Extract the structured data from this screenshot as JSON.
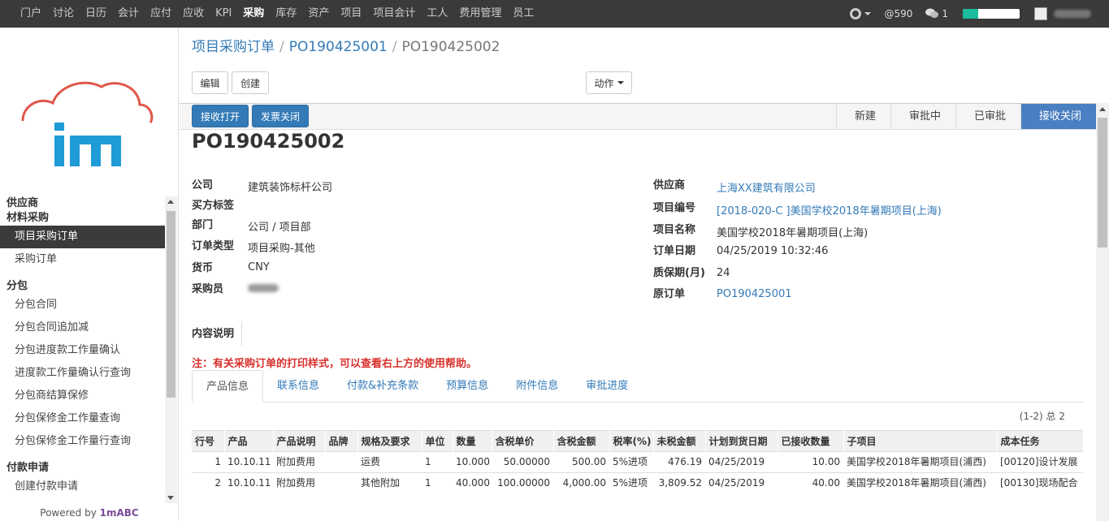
{
  "topmenu": [
    "门户",
    "讨论",
    "日历",
    "会计",
    "应付",
    "应收",
    "KPI",
    "采购",
    "库存",
    "资产",
    "项目",
    "项目会计",
    "工人",
    "费用管理",
    "员工"
  ],
  "topmenu_active": "采购",
  "topbar": {
    "at_count": "@590",
    "chat_count": "1",
    "progress_fraction": 0.27,
    "accent": "#1abc9c"
  },
  "sidebar": {
    "groups": [
      {
        "title": "供应商",
        "items": []
      },
      {
        "title": "材料采购",
        "items": [
          "项目采购订单",
          "采购订单"
        ]
      },
      {
        "title": "分包",
        "items": [
          "分包合同",
          "分包合同追加减",
          "分包进度款工作量确认",
          "进度款工作量确认行查询",
          "分包商结算保修",
          "分包保修金工作量查询",
          "分包保修金工作量行查询"
        ]
      },
      {
        "title": "付款申请",
        "items": [
          "创建付款申请"
        ]
      }
    ],
    "active_item": "项目采购订单",
    "powered_prefix": "Powered by ",
    "powered_brand": "1mABC"
  },
  "breadcrumb": {
    "root": "项目采购订单",
    "parent": "PO190425001",
    "current": "PO190425002"
  },
  "toolbar": {
    "edit": "编辑",
    "create": "创建",
    "action": "动作"
  },
  "status_buttons": {
    "receive_open": "接收打开",
    "invoice_close": "发票关闭"
  },
  "stages": [
    "新建",
    "审批中",
    "已审批",
    "接收关闭"
  ],
  "active_stage": "接收关闭",
  "doc_name": "PO190425002",
  "left_fields": [
    {
      "label": "公司",
      "value": "建筑装饰标杆公司"
    },
    {
      "label": "买方标签",
      "value": ""
    },
    {
      "label": "部门",
      "value": "公司 / 项目部"
    },
    {
      "label": "订单类型",
      "value": "项目采购-其他"
    },
    {
      "label": "货币",
      "value": "CNY"
    },
    {
      "label": "采购员",
      "value": ""
    }
  ],
  "right_fields": [
    {
      "label": "供应商",
      "value": "上海XX建筑有限公司",
      "link": true
    },
    {
      "label": "项目编号",
      "value": "[2018-020-C ]美国学校2018年暑期项目(上海)",
      "link": true
    },
    {
      "label": "项目名称",
      "value": "美国学校2018年暑期项目(上海)",
      "link": false
    },
    {
      "label": "订单日期",
      "value": "04/25/2019 10:32:46",
      "link": false
    },
    {
      "label": "质保期(月)",
      "value": "24",
      "link": false
    },
    {
      "label": "原订单",
      "value": "PO190425001",
      "link": true
    }
  ],
  "content_label": "内容说明",
  "note": "注：有关采购订单的打印样式，可以查看右上方的使用帮助。",
  "tabs": [
    "产品信息",
    "联系信息",
    "付款&补充条款",
    "预算信息",
    "附件信息",
    "审批进度"
  ],
  "active_tab": "产品信息",
  "pager": "(1-2) 总 2",
  "table": {
    "headers": [
      "行号",
      "产品",
      "产品说明",
      "品牌",
      "规格及要求",
      "单位",
      "数量",
      "含税单价",
      "含税金额",
      "税率(%)",
      "未税金额",
      "计划到货日期",
      "已接收数量",
      "子项目",
      "成本任务"
    ],
    "rows": [
      [
        "1",
        "10.10.11",
        "附加费用",
        "",
        "运费",
        "1",
        "10.000",
        "50.00000",
        "500.00",
        "5%进项",
        "476.19",
        "04/25/2019",
        "10.00",
        "美国学校2018年暑期项目(浦西)",
        "[00120]设计发展"
      ],
      [
        "2",
        "10.10.11",
        "附加费用",
        "",
        "其他附加",
        "1",
        "40.000",
        "100.00000",
        "4,000.00",
        "5%进项",
        "3,809.52",
        "04/25/2019",
        "40.00",
        "美国学校2018年暑期项目(浦西)",
        "[00130]现场配合"
      ]
    ]
  }
}
